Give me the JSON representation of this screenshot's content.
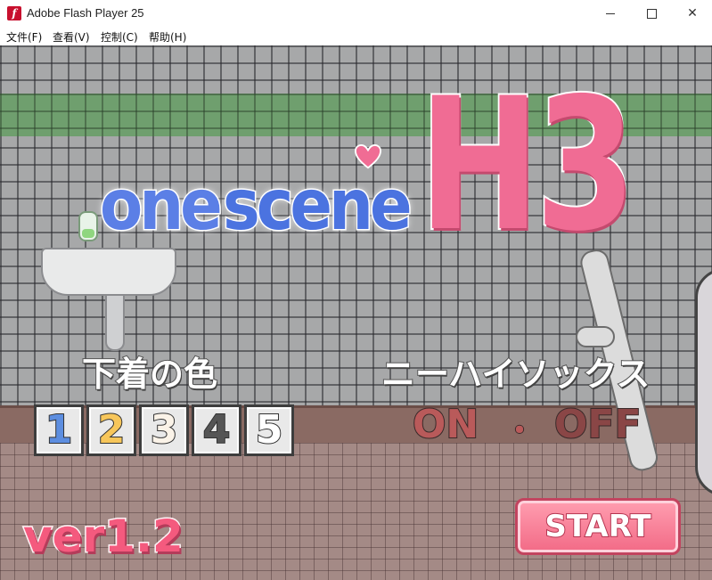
{
  "window": {
    "title": "Adobe Flash Player 25",
    "icon": "flash-icon",
    "icon_glyph": "f",
    "controls": {
      "close": "✕"
    }
  },
  "menu": {
    "items": [
      {
        "label": "文件(F)"
      },
      {
        "label": "查看(V)"
      },
      {
        "label": "控制(C)"
      },
      {
        "label": "帮助(H)"
      }
    ]
  },
  "game": {
    "logo": {
      "one": "one",
      "scene": "scene",
      "h3": "H3"
    },
    "underwear": {
      "label": "下着の色",
      "options": [
        "1",
        "2",
        "3",
        "4",
        "5"
      ]
    },
    "socks": {
      "label": "ニーハイソックス",
      "on": "ON",
      "separator": "・",
      "off": "OFF"
    },
    "version": "ver1.2",
    "start": "START"
  },
  "colors": {
    "logo_blue": "#4b73e0",
    "logo_pink": "#f06c94",
    "heart": "#f06c94",
    "start_button": "#f26a86"
  }
}
